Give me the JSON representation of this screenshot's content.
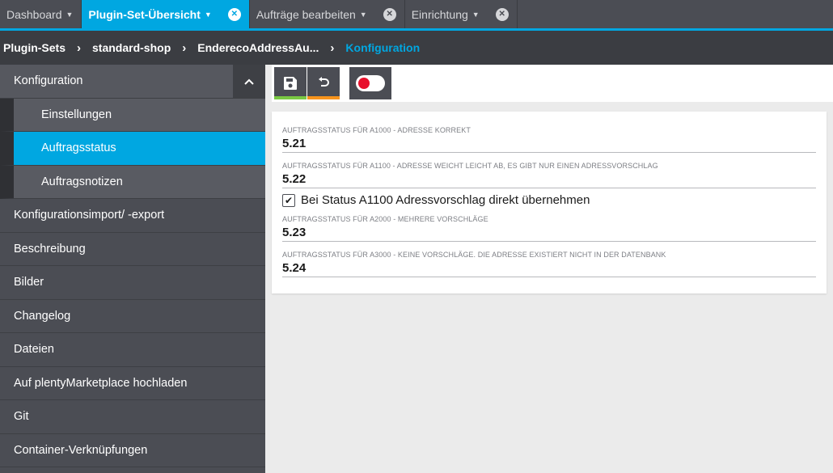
{
  "tabs": [
    {
      "label": "Dashboard",
      "active": false,
      "closable": false
    },
    {
      "label": "Plugin-Set-Übersicht",
      "active": true,
      "closable": true
    },
    {
      "label": "Aufträge bearbeiten",
      "active": false,
      "closable": true
    },
    {
      "label": "Einrichtung",
      "active": false,
      "closable": true
    }
  ],
  "breadcrumb": [
    "Plugin-Sets",
    "standard-shop",
    "EnderecoAddressAu...",
    "Konfiguration"
  ],
  "sidebar": {
    "header": "Konfiguration",
    "subitems": [
      "Einstellungen",
      "Auftragsstatus",
      "Auftragsnotizen"
    ],
    "active_subitem": "Auftragsstatus",
    "items": [
      "Konfigurationsimport/ -export",
      "Beschreibung",
      "Bilder",
      "Changelog",
      "Dateien",
      "Auf plentyMarketplace hochladen",
      "Git",
      "Container-Verknüpfungen"
    ]
  },
  "toolbar": {
    "save_icon": "save-icon",
    "undo_icon": "undo-icon",
    "save_bar_color": "#7ac943",
    "undo_bar_color": "#f7941d",
    "toggle_color": "#e8112d"
  },
  "form": {
    "fields": [
      {
        "label": "Auftragsstatus für A1000 - Adresse korrekt",
        "value": "5.21"
      },
      {
        "label": "Auftragsstatus für A1100 - Adresse weicht leicht ab, es gibt nur einen Adressvorschlag",
        "value": "5.22"
      },
      {
        "label": "Auftragsstatus für A2000 - mehrere Vorschläge",
        "value": "5.23"
      },
      {
        "label": "Auftragsstatus für A3000 - keine Vorschläge. Die Adresse existiert nicht in der Datenbank",
        "value": "5.24"
      }
    ],
    "checkbox": {
      "label": "Bei Status A1100 Adressvorschlag direkt übernehmen",
      "checked": true
    }
  },
  "colors": {
    "accent": "#00a7e1",
    "sidebar": "#4b4d54"
  }
}
